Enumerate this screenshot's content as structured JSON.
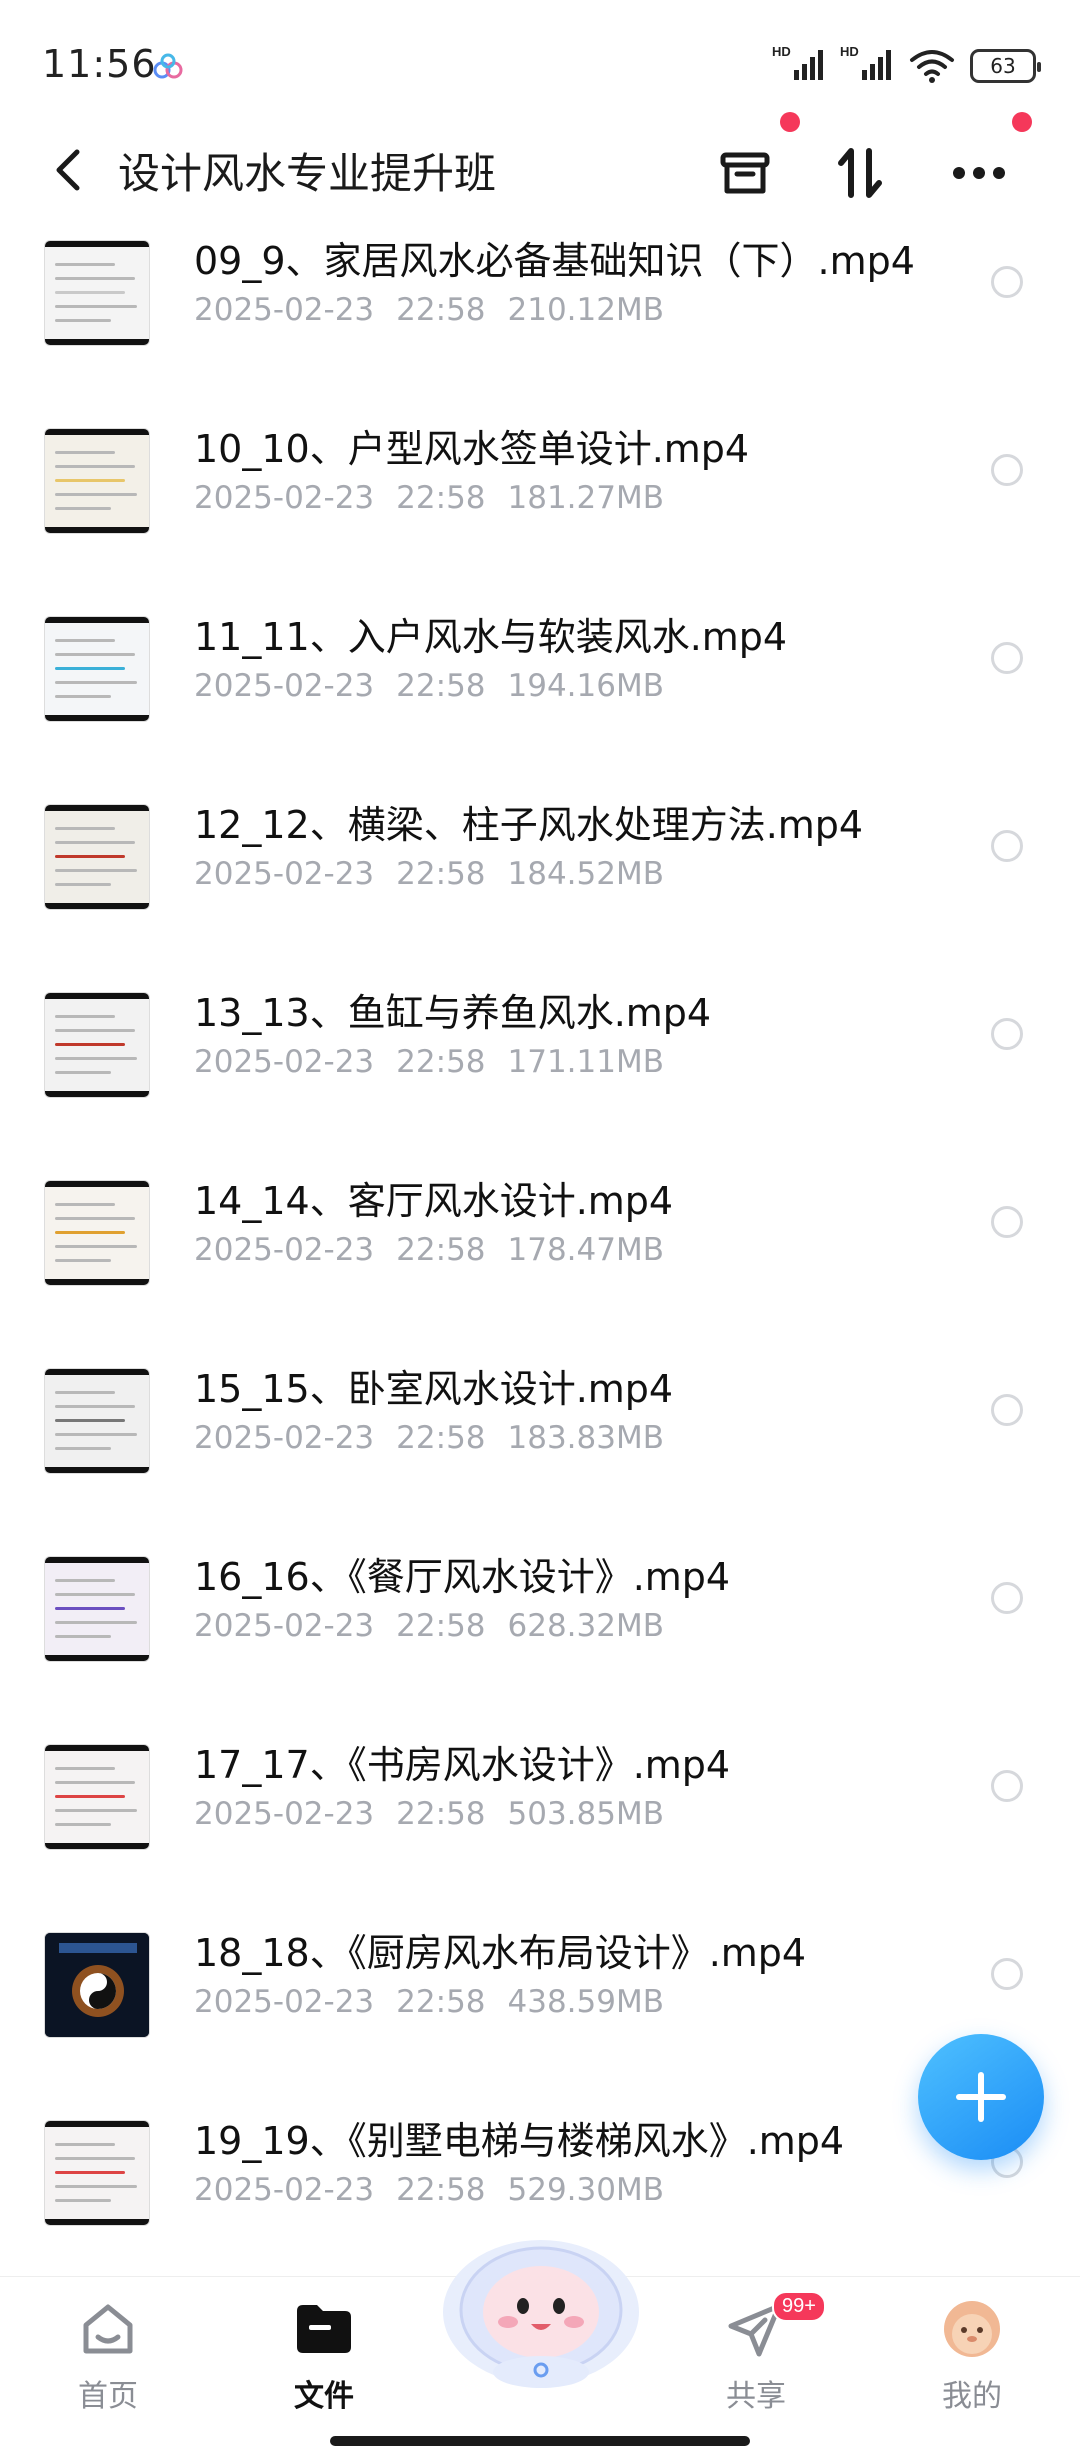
{
  "status_bar": {
    "time": "11:56",
    "signal1_label": "HD",
    "signal2_label": "HD",
    "battery": "63"
  },
  "header": {
    "back_icon": "chevron-left-icon",
    "title": "设计风水专业提升班",
    "actions": [
      "archive-box-icon",
      "sort-icon",
      "more-icon"
    ],
    "notification_dot_color": "#f5385a"
  },
  "files": [
    {
      "name": "09_9、家居风水必备基础知识（下）.mp4",
      "date": "2025-02-23",
      "time": "22:58",
      "size": "210.12MB",
      "thumb": "chart-sheet"
    },
    {
      "name": "10_10、户型风水签单设计.mp4",
      "date": "2025-02-23",
      "time": "22:58",
      "size": "181.27MB",
      "thumb": "palm-slide"
    },
    {
      "name": "11_11、入户风水与软装风水.mp4",
      "date": "2025-02-23",
      "time": "22:58",
      "size": "194.16MB",
      "thumb": "grid-slide"
    },
    {
      "name": "12_12、横梁、柱子风水处理方法.mp4",
      "date": "2025-02-23",
      "time": "22:58",
      "size": "184.52MB",
      "thumb": "compass-slide"
    },
    {
      "name": "13_13、鱼缸与养鱼风水.mp4",
      "date": "2025-02-23",
      "time": "22:58",
      "size": "171.11MB",
      "thumb": "fish-slide"
    },
    {
      "name": "14_14、客厅风水设计.mp4",
      "date": "2025-02-23",
      "time": "22:58",
      "size": "178.47MB",
      "thumb": "table-slide"
    },
    {
      "name": "15_15、卧室风水设计.mp4",
      "date": "2025-02-23",
      "time": "22:58",
      "size": "183.83MB",
      "thumb": "text-slide"
    },
    {
      "name": "16_16、《餐厅风水设计》.mp4",
      "date": "2025-02-23",
      "time": "22:58",
      "size": "628.32MB",
      "thumb": "bagua-slide"
    },
    {
      "name": "17_17、《书房风水设计》.mp4",
      "date": "2025-02-23",
      "time": "22:58",
      "size": "503.85MB",
      "thumb": "text-red-slide"
    },
    {
      "name": "18_18、《厨房风水布局设计》.mp4",
      "date": "2025-02-23",
      "time": "22:58",
      "size": "438.59MB",
      "thumb": "taiji-dark"
    },
    {
      "name": "19_19、《别墅电梯与楼梯风水》.mp4",
      "date": "2025-02-23",
      "time": "22:58",
      "size": "529.30MB",
      "thumb": "text-red-slide"
    }
  ],
  "fab": {
    "icon": "plus-icon",
    "color": "#1a8cf5"
  },
  "bottom_nav": {
    "items": [
      {
        "label": "首页",
        "icon": "home-icon",
        "active": false
      },
      {
        "label": "文件",
        "icon": "folder-icon",
        "active": true
      },
      {
        "label": "共享",
        "icon": "send-icon",
        "active": false,
        "badge": "99+"
      },
      {
        "label": "我的",
        "icon": "avatar-icon",
        "active": false
      }
    ],
    "center_icon": "mascot-icon"
  }
}
